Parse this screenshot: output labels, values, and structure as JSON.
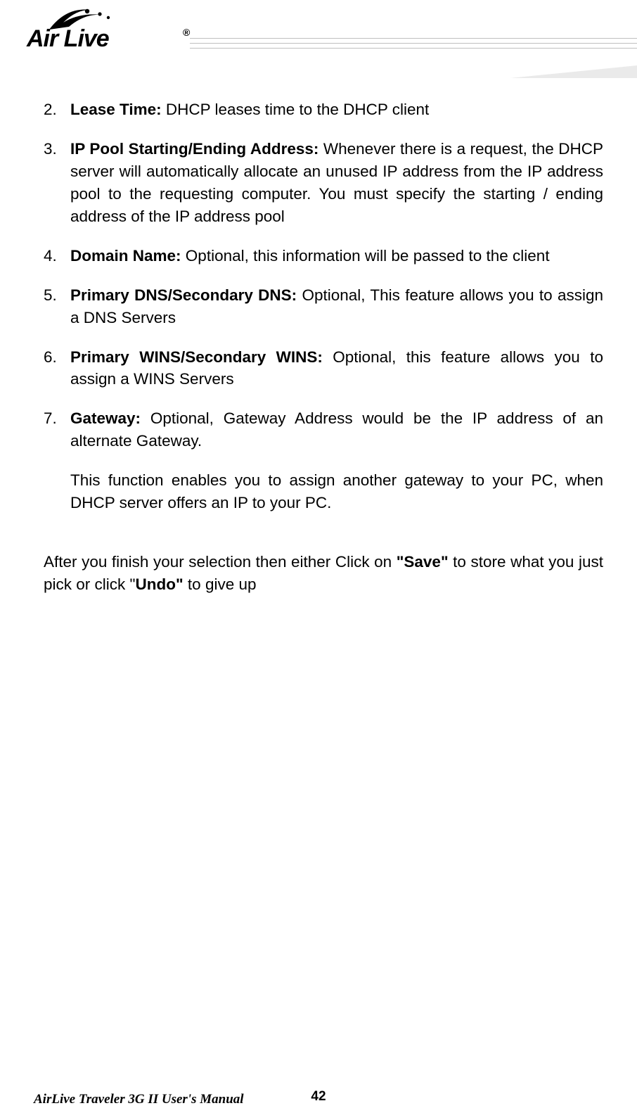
{
  "logo": {
    "brand": "Air Live",
    "trademark": "®"
  },
  "list": {
    "item2": {
      "num": "2.",
      "title": "Lease Time:",
      "body": " DHCP leases time to the DHCP client"
    },
    "item3": {
      "num": "3.",
      "title": "IP Pool Starting/Ending Address:",
      "body": " Whenever there is a request, the DHCP server will automatically allocate an unused IP address from the IP address pool to the requesting computer. You must specify the starting / ending address of the IP address pool"
    },
    "item4": {
      "num": "4.",
      "title": "Domain Name:",
      "body": " Optional, this information will be passed to the client"
    },
    "item5": {
      "num": "5.",
      "title": "Primary DNS/Secondary DNS:",
      "body": " Optional, This feature allows you to assign a DNS Servers"
    },
    "item6": {
      "num": "6.",
      "title": "Primary WINS/Secondary WINS:",
      "body": " Optional, this feature allows you to assign a WINS Servers"
    },
    "item7": {
      "num": "7.",
      "title": "Gateway:",
      "body": " Optional, Gateway Address would be the IP address of an alternate Gateway."
    },
    "item7_extra": "This function enables you to assign another gateway to your PC, when DHCP server offers an IP to your PC."
  },
  "closing": {
    "part1": "After you finish your selection then either Click on ",
    "save": "\"Save\"",
    "part2": " to store what you just pick or click \"",
    "undo": "Undo\"",
    "part3": " to give up"
  },
  "footer": {
    "title": "AirLive Traveler 3G II User's Manual",
    "page": "42"
  }
}
